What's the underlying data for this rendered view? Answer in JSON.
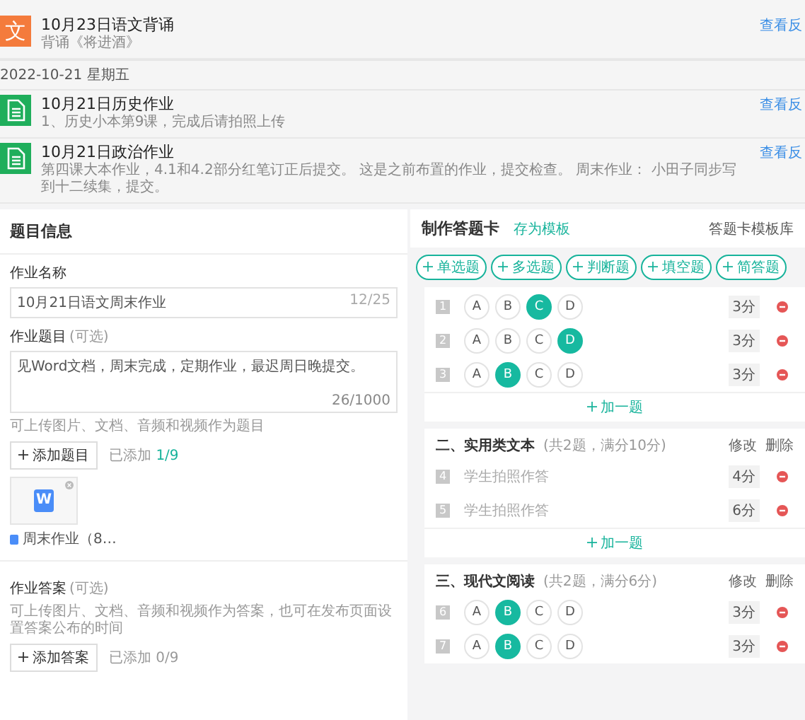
{
  "feed": [
    {
      "kind": "item",
      "glyph": "文",
      "title": "10月23日语文背诵",
      "subtitle": "背诵《将进酒》",
      "link": "查看反"
    },
    {
      "kind": "date",
      "text": "2022-10-21 星期五"
    },
    {
      "kind": "item",
      "title": "10月21日历史作业",
      "subtitle": "1、历史小本第9课，完成后请拍照上传",
      "link": "查看反"
    },
    {
      "kind": "item",
      "title": "10月21日政治作业",
      "subtitle": "第四课大本作业，4.1和4.2部分红笔订正后提交。 这是之前布置的作业，提交检查。 周末作业： 小田子同步写到十二续集，提交。",
      "link": "查看反"
    }
  ],
  "info": {
    "title": "题目信息",
    "name": {
      "label": "作业名称",
      "value": "10月21日语文周末作业",
      "count": "12/25"
    },
    "question": {
      "label": "作业题目",
      "optional": "(可选)",
      "value": "见Word文档，周末完成，定期作业，最迟周日晚提交。",
      "count": "26/1000",
      "hint": "可上传图片、文档、音频和视频作为题目",
      "button": "添加题目",
      "added_label": "已添加",
      "added": "1/9",
      "file": {
        "glyph": "W",
        "name": "周末作业（8…"
      }
    },
    "answer": {
      "label": "作业答案",
      "optional": "(可选)",
      "hint": "可上传图片、文档、音频和视频作为答案，也可在发布页面设置答案公布的时间",
      "button": "添加答案",
      "added_label": "已添加",
      "added": "0/9"
    }
  },
  "card": {
    "title": "制作答题卡",
    "save": "存为模板",
    "library": "答题卡模板库",
    "types": [
      "单选题",
      "多选题",
      "判断题",
      "填空题",
      "简答题"
    ],
    "sections": [
      {
        "questions": [
          {
            "kind": "choice",
            "num": "1",
            "options": [
              {
                "label": "A",
                "selected": false
              },
              {
                "label": "B",
                "selected": false
              },
              {
                "label": "C",
                "selected": true
              },
              {
                "label": "D",
                "selected": false
              }
            ],
            "score": "3分"
          },
          {
            "kind": "choice",
            "num": "2",
            "options": [
              {
                "label": "A",
                "selected": false
              },
              {
                "label": "B",
                "selected": false
              },
              {
                "label": "C",
                "selected": false
              },
              {
                "label": "D",
                "selected": true
              }
            ],
            "score": "3分"
          },
          {
            "kind": "choice",
            "num": "3",
            "options": [
              {
                "label": "A",
                "selected": false
              },
              {
                "label": "B",
                "selected": true
              },
              {
                "label": "C",
                "selected": false
              },
              {
                "label": "D",
                "selected": false
              }
            ],
            "score": "3分"
          }
        ],
        "add": "加一题"
      },
      {
        "title": "二、实用类文本",
        "meta": "(共2题，满分10分)",
        "edit": "修改",
        "delete": "删除",
        "questions": [
          {
            "kind": "photo",
            "num": "4",
            "text": "学生拍照作答",
            "score": "4分"
          },
          {
            "kind": "photo",
            "num": "5",
            "text": "学生拍照作答",
            "score": "6分"
          }
        ],
        "add": "加一题"
      },
      {
        "title": "三、现代文阅读",
        "meta": "(共2题，满分6分)",
        "edit": "修改",
        "delete": "删除",
        "questions": [
          {
            "kind": "choice",
            "num": "6",
            "options": [
              {
                "label": "A",
                "selected": false
              },
              {
                "label": "B",
                "selected": true
              },
              {
                "label": "C",
                "selected": false
              },
              {
                "label": "D",
                "selected": false
              }
            ],
            "score": "3分"
          },
          {
            "kind": "choice",
            "num": "7",
            "options": [
              {
                "label": "A",
                "selected": false
              },
              {
                "label": "B",
                "selected": true
              },
              {
                "label": "C",
                "selected": false
              },
              {
                "label": "D",
                "selected": false
              }
            ],
            "score": "3分"
          }
        ]
      }
    ]
  }
}
